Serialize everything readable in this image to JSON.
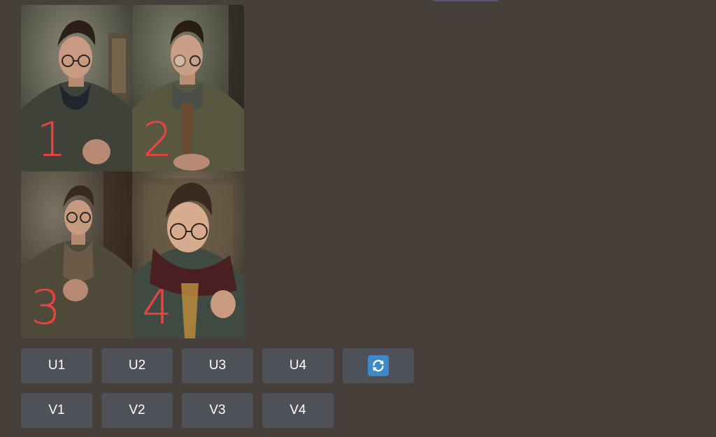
{
  "image_grid": {
    "tiles": [
      {
        "number": "1",
        "palette": {
          "bg": "#4a4b40",
          "glow": "#8b8a78",
          "coat": "#3f4238",
          "scarf": "#1f2630",
          "skin": "#c89a82",
          "hair": "#2b1f18"
        }
      },
      {
        "number": "2",
        "palette": {
          "bg": "#3e4033",
          "glow": "#7c7d69",
          "coat": "#5a5740",
          "scarf": "#4a4e48",
          "skin": "#c9a087",
          "hair": "#2a1d14"
        }
      },
      {
        "number": "3",
        "palette": {
          "bg": "#3a3228",
          "glow": "#7b7362",
          "coat": "#504a3b",
          "scarf": "#6b5a45",
          "skin": "#c69a7f",
          "hair": "#3a2a1d"
        }
      },
      {
        "number": "4",
        "palette": {
          "bg": "#4a4135",
          "glow": "#8a7c64",
          "coat": "#3e4a42",
          "scarf": "#4a1f22",
          "skin": "#d7ab8d",
          "hair": "#3a2a1f"
        }
      }
    ]
  },
  "upscale_buttons": [
    "U1",
    "U2",
    "U3",
    "U4"
  ],
  "variation_buttons": [
    "V1",
    "V2",
    "V3",
    "V4"
  ],
  "reroll_button": {
    "icon": "refresh-icon"
  },
  "colors": {
    "background": "#463f3a",
    "button": "#4e5158",
    "number_overlay": "#f0423c",
    "reroll_icon_bg": "#3c88c8"
  }
}
